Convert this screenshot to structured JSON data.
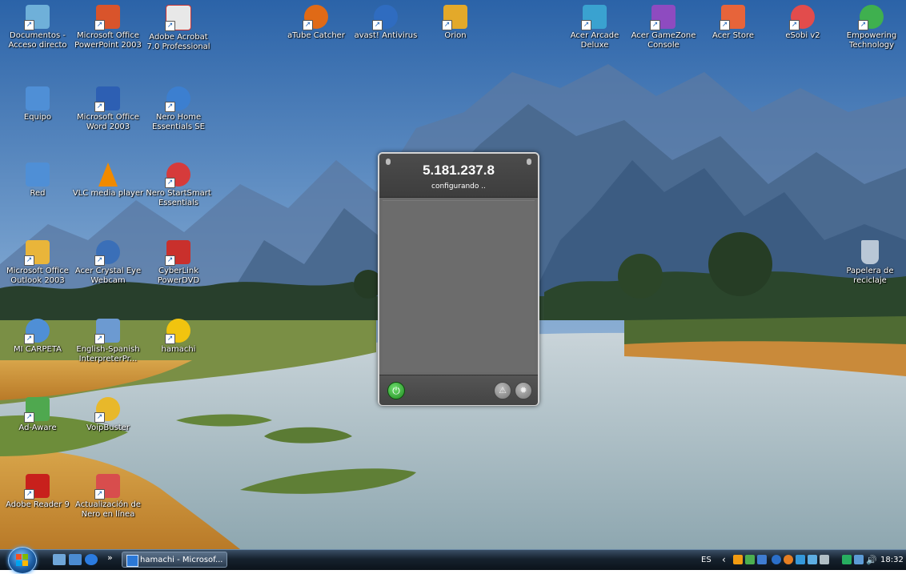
{
  "desktop_icons": [
    {
      "id": "documentos",
      "label": "Documentos - Acceso directo",
      "icon": "folder-shortcut-icon",
      "color": "#6fb0d9"
    },
    {
      "id": "ppt2003",
      "label": "Microsoft Office PowerPoint 2003",
      "icon": "powerpoint-icon",
      "color": "#d9542b"
    },
    {
      "id": "acrobat7",
      "label": "Adobe Acrobat 7.0 Professional",
      "icon": "acrobat-icon",
      "color": "#e8e8e8"
    },
    {
      "id": "atube",
      "label": "aTube Catcher",
      "icon": "atube-icon",
      "color": "#e06a16"
    },
    {
      "id": "avast",
      "label": "avast! Antivirus",
      "icon": "avast-icon",
      "color": "#2f6cc0"
    },
    {
      "id": "orion",
      "label": "Orion",
      "icon": "orion-icon",
      "color": "#e3a92a"
    },
    {
      "id": "arcade",
      "label": "Acer Arcade Deluxe",
      "icon": "acer-arcade-icon",
      "color": "#3aa2d0"
    },
    {
      "id": "gamezone",
      "label": "Acer GameZone Console",
      "icon": "gamezone-icon",
      "color": "#8e4bc0"
    },
    {
      "id": "acerstore",
      "label": "Acer Store",
      "icon": "acer-store-icon",
      "color": "#e7643a"
    },
    {
      "id": "esobi",
      "label": "eSobi v2",
      "icon": "esobi-icon",
      "color": "#e24c4c"
    },
    {
      "id": "empowering",
      "label": "Empowering Technology",
      "icon": "empowering-icon",
      "color": "#3fb04f"
    },
    {
      "id": "equipo",
      "label": "Equipo",
      "icon": "computer-icon",
      "color": "#4f8fd6"
    },
    {
      "id": "word2003",
      "label": "Microsoft Office Word 2003",
      "icon": "word-icon",
      "color": "#2d5fb3"
    },
    {
      "id": "nerohome",
      "label": "Nero Home Essentials SE",
      "icon": "nero-home-icon",
      "color": "#3c7fd0"
    },
    {
      "id": "red",
      "label": "Red",
      "icon": "network-icon",
      "color": "#4f8fd6"
    },
    {
      "id": "vlc",
      "label": "VLC media player",
      "icon": "vlc-icon",
      "color": "#f08a00"
    },
    {
      "id": "nerostart",
      "label": "Nero StartSmart Essentials",
      "icon": "nero-startsmart-icon",
      "color": "#d63b3b"
    },
    {
      "id": "outlook2003",
      "label": "Microsoft Office Outlook 2003",
      "icon": "outlook-icon",
      "color": "#e9b53a"
    },
    {
      "id": "crystaleye",
      "label": "Acer Crystal Eye Webcam",
      "icon": "webcam-icon",
      "color": "#3a6fb8"
    },
    {
      "id": "powerdvd",
      "label": "CyberLink PowerDVD",
      "icon": "powerdvd-icon",
      "color": "#c9302c"
    },
    {
      "id": "micarpeta",
      "label": "MI CARPETA",
      "icon": "folder-shortcut-icon",
      "color": "#4f8fd6"
    },
    {
      "id": "engspa",
      "label": "English-Spanish InterpreterPr...",
      "icon": "translator-icon",
      "color": "#6c9ad1"
    },
    {
      "id": "hamachi",
      "label": "hamachi",
      "icon": "hamachi-icon",
      "color": "#f1c40f"
    },
    {
      "id": "adaware",
      "label": "Ad-Aware",
      "icon": "adaware-icon",
      "color": "#4fa84f"
    },
    {
      "id": "voipbuster",
      "label": "VoipBuster",
      "icon": "voipbuster-icon",
      "color": "#e8b82a"
    },
    {
      "id": "reader9",
      "label": "Adobe Reader 9",
      "icon": "adobe-reader-icon",
      "color": "#c8201c"
    },
    {
      "id": "neroupdate",
      "label": "Actualización de Nero en línea",
      "icon": "nero-update-icon",
      "color": "#d84d4d"
    },
    {
      "id": "papelera",
      "label": "Papelera de reciclaje",
      "icon": "recycle-bin-icon",
      "color": "#b9c7d6"
    }
  ],
  "hamachi_window": {
    "ip": "5.181.237.8",
    "status": "configurando ..",
    "power_icon": "power-icon",
    "network_icon": "network-icon",
    "settings_icon": "settings-gear-icon",
    "power_color": "#2fae2f"
  },
  "taskbar": {
    "chevron": "»",
    "active_task": "hamachi - Microsof...",
    "language": "ES",
    "tray_chevron": "‹",
    "clock": "18:32"
  }
}
